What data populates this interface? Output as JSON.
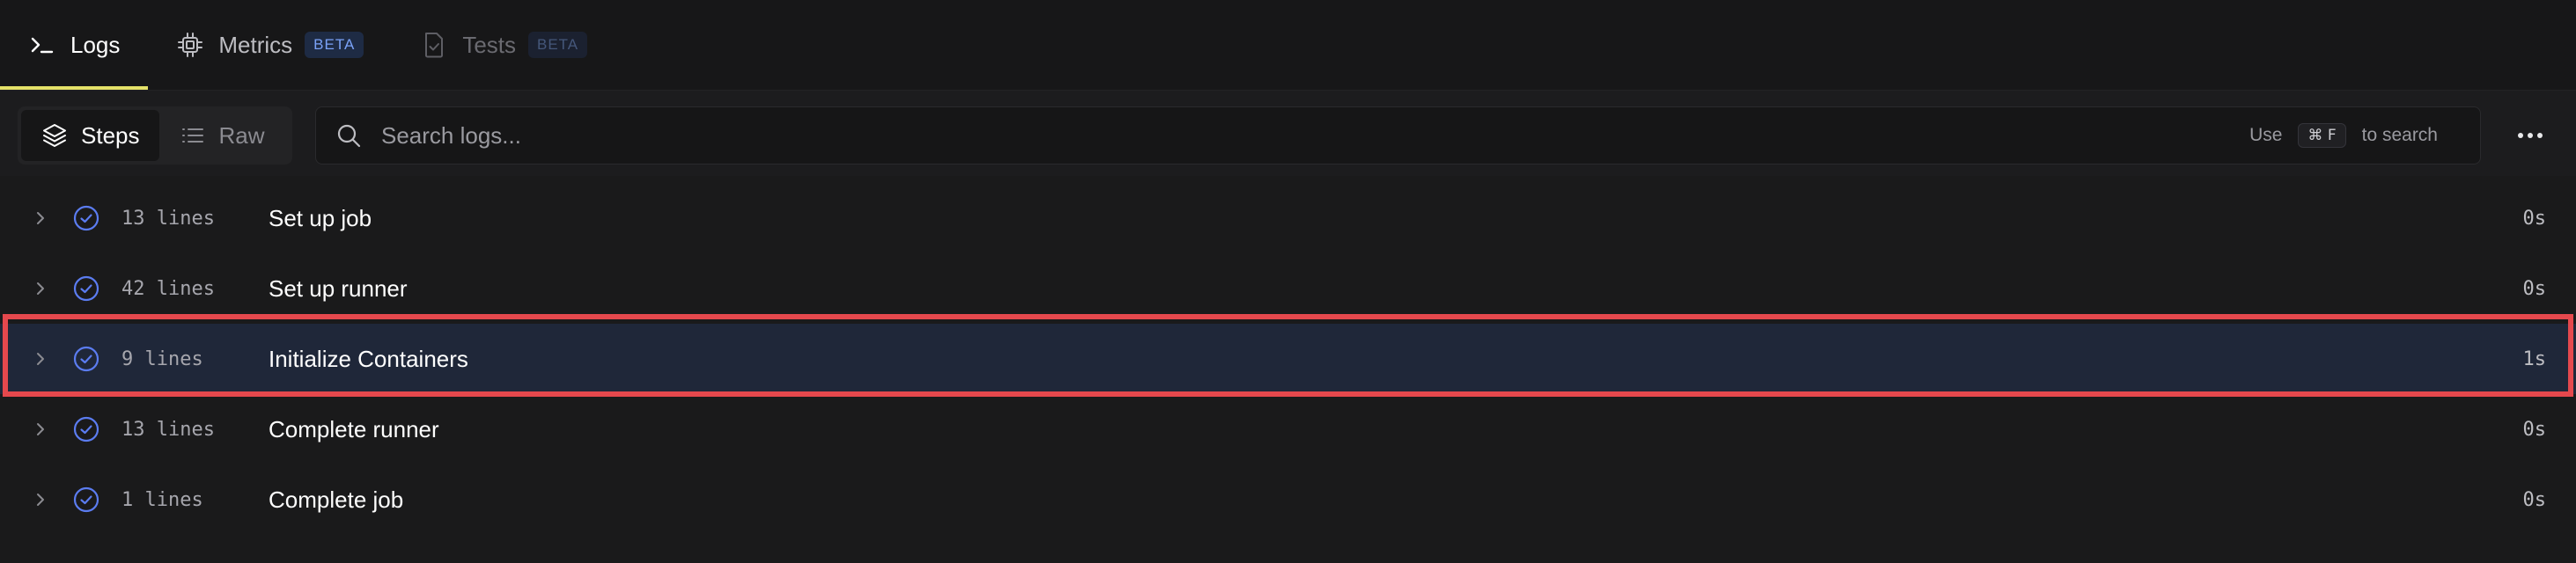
{
  "tabs": [
    {
      "label": "Logs",
      "icon": "terminal-icon",
      "active": true
    },
    {
      "label": "Metrics",
      "icon": "chip-icon",
      "badge": "BETA"
    },
    {
      "label": "Tests",
      "icon": "file-check-icon",
      "badge": "BETA",
      "disabled": true
    }
  ],
  "toolbar": {
    "view_modes": [
      {
        "label": "Steps",
        "icon": "layers-icon",
        "active": true
      },
      {
        "label": "Raw",
        "icon": "list-icon"
      }
    ],
    "search": {
      "placeholder": "Search logs...",
      "hint_prefix": "Use",
      "shortcut": "⌘ F",
      "hint_suffix": "to search"
    },
    "more_icon": "more-horizontal-icon"
  },
  "steps": [
    {
      "lines": "13 lines",
      "name": "Set up job",
      "duration": "0s",
      "status": "success"
    },
    {
      "lines": "42 lines",
      "name": "Set up runner",
      "duration": "0s",
      "status": "success"
    },
    {
      "lines": "9 lines",
      "name": "Initialize Containers",
      "duration": "1s",
      "status": "success",
      "highlighted": true
    },
    {
      "lines": "13 lines",
      "name": "Complete runner",
      "duration": "0s",
      "status": "success"
    },
    {
      "lines": "1 lines",
      "name": "Complete job",
      "duration": "0s",
      "status": "success"
    }
  ],
  "colors": {
    "accent_tab_underline": "#e4e169",
    "success_icon": "#5b7cf0",
    "highlight_row": "#1f2739",
    "annotation_box": "#e5484d",
    "badge_text": "#7aa2f7"
  }
}
